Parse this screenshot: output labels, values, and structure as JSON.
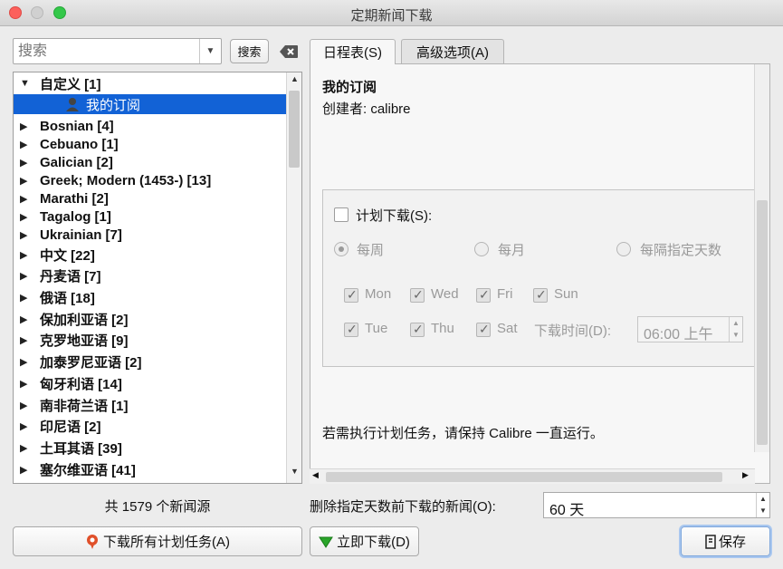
{
  "window": {
    "title": "定期新闻下载"
  },
  "search": {
    "placeholder": "搜索",
    "button_label": "搜索"
  },
  "tree": {
    "items": [
      {
        "label": "自定义 [1]",
        "arrow": "▼"
      },
      {
        "label": "我的订阅",
        "selected": true
      },
      {
        "label": "Bosnian [4]",
        "arrow": "▶"
      },
      {
        "label": "Cebuano [1]",
        "arrow": "▶"
      },
      {
        "label": "Galician [2]",
        "arrow": "▶"
      },
      {
        "label": "Greek; Modern (1453-) [13]",
        "arrow": "▶"
      },
      {
        "label": "Marathi [2]",
        "arrow": "▶"
      },
      {
        "label": "Tagalog [1]",
        "arrow": "▶"
      },
      {
        "label": "Ukrainian [7]",
        "arrow": "▶"
      },
      {
        "label": "中文 [22]",
        "arrow": "▶"
      },
      {
        "label": "丹麦语 [7]",
        "arrow": "▶"
      },
      {
        "label": "俄语 [18]",
        "arrow": "▶"
      },
      {
        "label": "保加利亚语 [2]",
        "arrow": "▶"
      },
      {
        "label": "克罗地亚语 [9]",
        "arrow": "▶"
      },
      {
        "label": "加泰罗尼亚语 [2]",
        "arrow": "▶"
      },
      {
        "label": "匈牙利语 [14]",
        "arrow": "▶"
      },
      {
        "label": "南非荷兰语 [1]",
        "arrow": "▶"
      },
      {
        "label": "印尼语 [2]",
        "arrow": "▶"
      },
      {
        "label": "土耳其语 [39]",
        "arrow": "▶"
      },
      {
        "label": "塞尔维亚语 [41]",
        "arrow": "▶"
      }
    ],
    "total": "共 1579 个新闻源"
  },
  "tabs": [
    {
      "label": "日程表(S)",
      "active": true
    },
    {
      "label": "高级选项(A)",
      "active": false
    }
  ],
  "schedule": {
    "title": "我的订阅",
    "creator": "创建者:  calibre",
    "enable_label": "计划下载(S):",
    "enabled": false,
    "radio_weekly": "每周",
    "radio_monthly": "每月",
    "radio_interval": "每隔指定天数",
    "days": [
      {
        "label": "Mon",
        "checked": true
      },
      {
        "label": "Wed",
        "checked": true
      },
      {
        "label": "Fri",
        "checked": true
      },
      {
        "label": "Sun",
        "checked": true
      },
      {
        "label": "Tue",
        "checked": true
      },
      {
        "label": "Thu",
        "checked": true
      },
      {
        "label": "Sat",
        "checked": true
      }
    ],
    "time_label": "下载时间(D):",
    "time_value": "06:00 上午",
    "note": "若需执行计划任务，请保持 Calibre 一直运行。"
  },
  "delete": {
    "label": "删除指定天数前下载的新闻(O):",
    "value": "60 天"
  },
  "buttons": {
    "download_all": "下载所有计划任务(A)",
    "download_now": "立即下载(D)",
    "save": "保存"
  },
  "colors": {
    "selection": "#1262d6",
    "download_now_icon": "#2aa52a",
    "download_all_icon": "#e0502a"
  }
}
